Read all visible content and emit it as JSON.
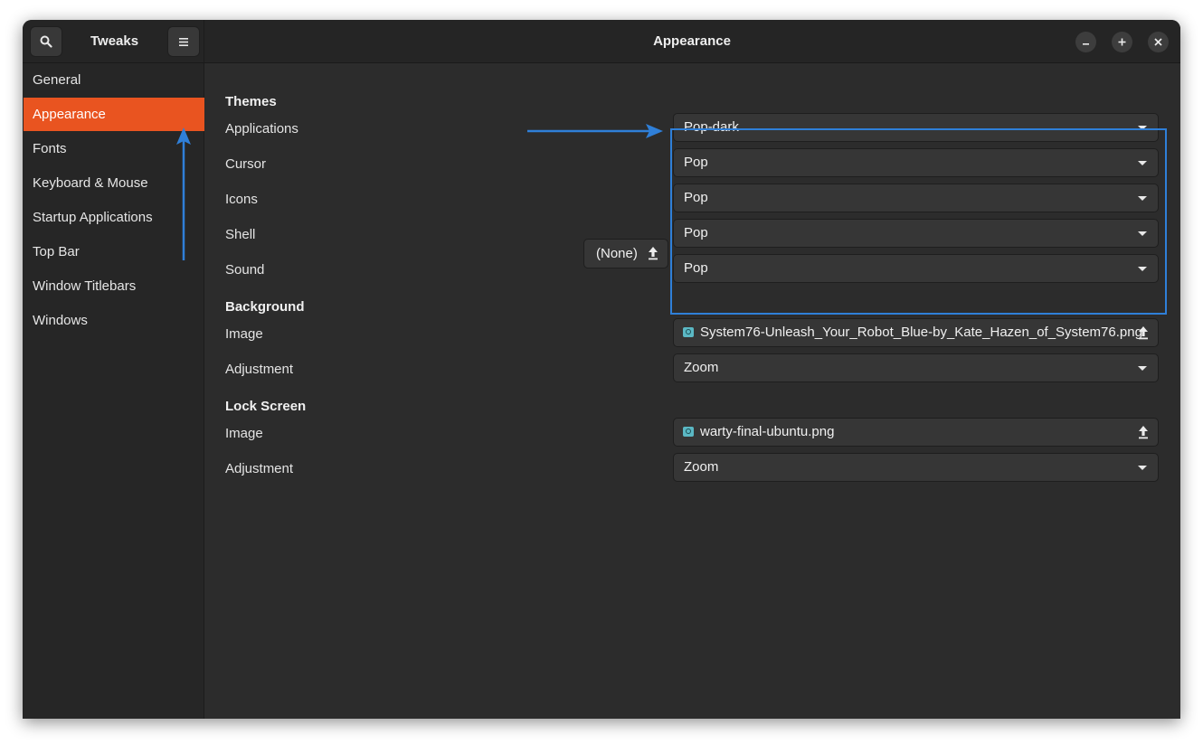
{
  "header": {
    "app_title": "Tweaks",
    "page_title": "Appearance"
  },
  "sidebar": {
    "items": [
      {
        "label": "General"
      },
      {
        "label": "Appearance"
      },
      {
        "label": "Fonts"
      },
      {
        "label": "Keyboard & Mouse"
      },
      {
        "label": "Startup Applications"
      },
      {
        "label": "Top Bar"
      },
      {
        "label": "Window Titlebars"
      },
      {
        "label": "Windows"
      }
    ],
    "active_index": 1
  },
  "themes": {
    "title": "Themes",
    "applications": {
      "label": "Applications",
      "value": "Pop-dark"
    },
    "cursor": {
      "label": "Cursor",
      "value": "Pop"
    },
    "icons": {
      "label": "Icons",
      "value": "Pop"
    },
    "shell": {
      "label": "Shell",
      "value": "Pop",
      "extension_button": "(None)"
    },
    "sound": {
      "label": "Sound",
      "value": "Pop"
    }
  },
  "background": {
    "title": "Background",
    "image": {
      "label": "Image",
      "value": "System76-Unleash_Your_Robot_Blue-by_Kate_Hazen_of_System76.png"
    },
    "adjustment": {
      "label": "Adjustment",
      "value": "Zoom"
    }
  },
  "lock_screen": {
    "title": "Lock Screen",
    "image": {
      "label": "Image",
      "value": "warty-final-ubuntu.png"
    },
    "adjustment": {
      "label": "Adjustment",
      "value": "Zoom"
    }
  },
  "colors": {
    "accent": "#e95420",
    "annotation": "#2f7fd8",
    "window_bg": "#2c2c2c"
  },
  "icons": {
    "search": "search-icon",
    "menu": "hamburger-menu-icon",
    "minimize": "minimize-icon",
    "maximize": "maximize-icon",
    "close": "close-icon",
    "upload": "upload-icon",
    "dropdown": "chevron-down-icon",
    "file": "image-file-icon"
  }
}
